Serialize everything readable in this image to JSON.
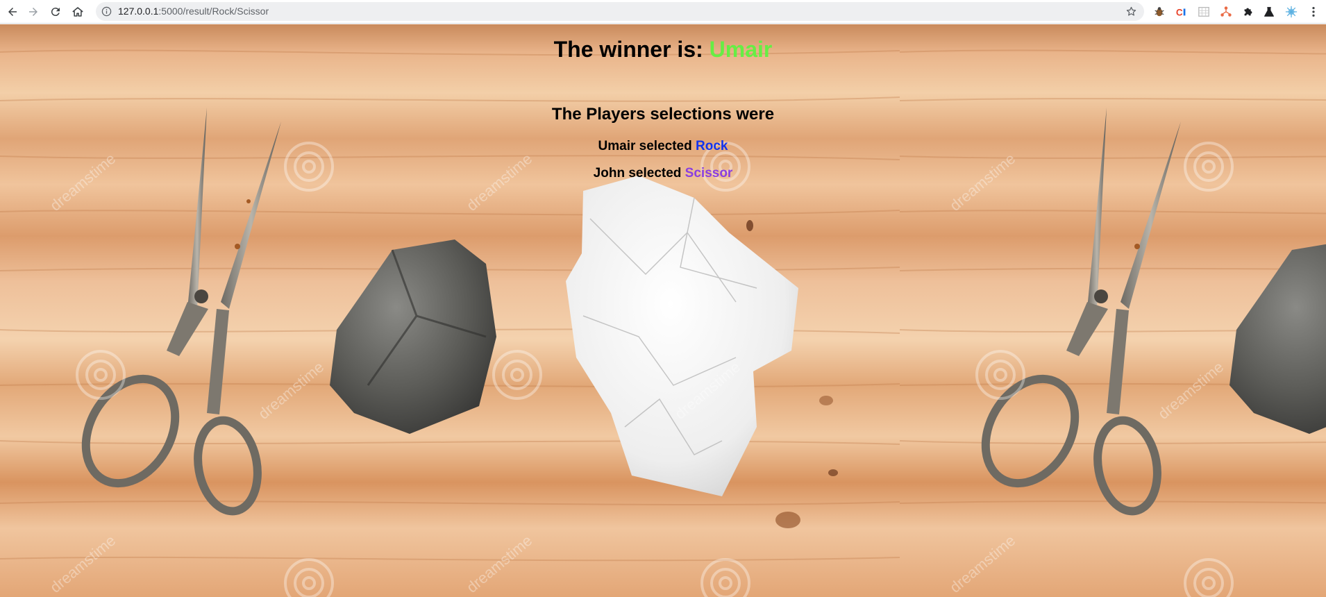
{
  "browser": {
    "url": "127.0.0.1:5000/result/Rock/Scissor",
    "url_host": "127.0.0.1",
    "url_rest": ":5000/result/Rock/Scissor"
  },
  "result": {
    "winner_prefix": "The winner is: ",
    "winner_name": "Umair",
    "winner_color": "#66ee44",
    "selections_title": "The Players selections were",
    "players": [
      {
        "name": "Umair",
        "verb": " selected ",
        "choice": "Rock",
        "choice_color": "#1133ee"
      },
      {
        "name": "John",
        "verb": " selected ",
        "choice": "Scissor",
        "choice_color": "#8a3fe0"
      }
    ]
  },
  "background": {
    "subject": "scissors, rock and crumpled paper on a wooden table",
    "watermark_text": "dreamstime"
  },
  "icons": [
    "back-icon",
    "forward-icon",
    "reload-icon",
    "home-icon",
    "info-icon",
    "star-icon",
    "extension-icon",
    "menu-icon"
  ]
}
